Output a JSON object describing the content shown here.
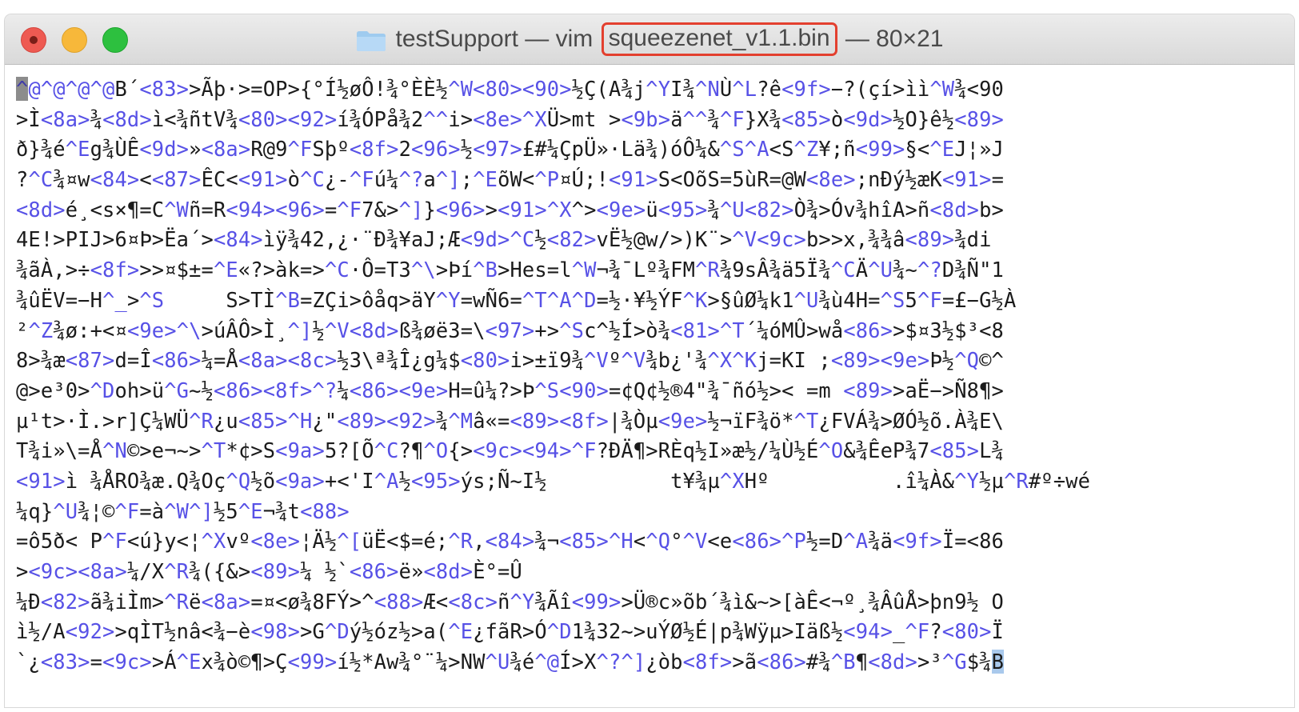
{
  "window": {
    "title_prefix": "testSupport — vim ",
    "title_file": "squeezenet_v1.1.bin",
    "title_suffix": " — 80×21",
    "controls": [
      "close",
      "minimize",
      "zoom"
    ]
  },
  "colors": {
    "text": "#1b1b1b",
    "special": "#5751e6",
    "highlight_box": "#e3402f",
    "cursor": "#8c8c8c"
  },
  "editor": {
    "lines": [
      "^@^@^@^@B´<83>>Ãþ·>=OP>{°Í½øÔ!¾°ÈÈ½^W<80><90>½Ç(A¾j^YI¾^NÙ^L?ê<9f>−?(çí>ìì^W¾<90",
      ">Ì<8a>¾<8d>ì<¾ñtV¾<80><92>í¾ÓPå¾2^^i><8e>^XÜ>mt ><9b>ä^^¾^F}X¾<85>ò<9d>½O}ê½<89>",
      "ð}¾é^Eg¾ÙÊ<9d>»<8a>R@9^FSþº<8f>2<96>½<97>£#¼ÇpÜ»·Lä¾)óÔ¼&^S^A<S^Z¥;ñ<99>§<^EJ¦»J",
      "?^C¾¤w<84><<87>ÊC<<91>ò^C¿-^Fú¼^?a^];^EõW<^P¤Ú;!<91>S<OõS=5ùR=@W<8e>;nÐý½æK<91>=",
      "<8d>é¸<s×¶=C^Wñ=R<94><96>=^F7&>^]}<96>><91>^X^><9e>ü<95>¾^U<82>Ò¾>Óv¾hîA>ñ<8d>b>",
      "4E!>PIJ>6¤Þ>Ëa´><84>ìÿ¾42,¿·¨Ð¾¥aJ;Æ<9d>^C½<82>vË½@w/>)K¨>^V<9c>b>>x,¾¾â<89>¾di",
      "¾ãÀ,>÷<8f>>>¤$±=^E«?>àk=>^C·Ô=T3^\\>Þí^B>Hes=l^W¬¾¯Lº¾FM^R¾9sÂ¾ä5Ï¾^CÄ^U¾~^?D¾Ñ\"1",
      "¾ûËV=−H^_>^S     S>TÌ^B=ZÇi>ôåq>äY^Y=wÑ6=^T^A^D=½·¥½ÝF^K>§ûØ¼k1^U¾ù4H=^S5^F=£−G½À",
      "²^Z¾ø:+<¤<9e>^\\>úÂÔ>Ì¸^]½^V<8d>ß¾øë3=\\<97>+>^Sc^½Í>ò¾<81>^T´¼óMÛ>wå<86>>$¤3½$³<8",
      "8>¾æ<87>d=Î<86>¼=Å<8a><8c>½3\\ª¾Î¿g¼$<80>i>±ï9¾^Vº^V¾b¿'¾^X^Kj=KI ;<89><9e>Þ½^Q©^",
      "@>e³0>^Doh>ü^G~½<86><8f>^?¼<86><9e>H=û¼?>Þ^S<90>=¢Q¢½®4\"¾¯ñó½>< =m <89>>aË−>Ñ8¶>",
      "µ¹t>·Ì.>r]Ç¼WÜ^R¿u<85>^H¿\"<89><92>¾^Mâ«=<89><8f>|¾Òµ<9e>½¬ïF¾ö*^T¿FVÁ¾>ØÓ½õ.À¾E\\",
      "T¾i»\\=Å^N©>e¬~>^T*¢>S<9a>5?[Õ^C?¶^O{><9c><94>^F?ÐÄ¶>RÈq½I»æ½/¼Ù½É^O&¾ÊeP¾7<85>L¾",
      "<91>ì ¾ÅRO¾æ.Q¾Oç^Q½õ<9a>+<'I^A½<95>ýs;Ñ~I½          t¥¾µ^XHº          .î¼À&^Y½µ^R#º÷wé",
      "¼q}^U¾¦©^F=à^W^]½5^E¬¾t<88>",
      "=ô5ð< P^F<ú}y<¦^Xvº<8e>¦Ä½^[üË<$=é;^R,<84>¾¬<85>^H<^Q°^V<e<86>^P½=D^A¾ä<9f>Ï=<86",
      "><9c><8a>¼/X^R¾({&><89>¼ ½`<86>ë»<8d>È°=Û",
      "¼Ð<82>ã¾iÌm>^Rë<8a>=¤<ø¾8FÝ>^<88>Æ<<8c>ñ^Y¾Ãî<99>>Ü®c»õb´¾ì&~>[àÊ<¬º¸¾ÂûÅ>þn9½ O",
      "ì½/A<92>>qÌT½nâ<¾−è<98>>G^Dý½óz½>a(^E¿fãR>Ó^D1¾32~>uÝØ½É|p¾Wÿµ>Iäß½<94>_^F?<80>Ï",
      "`¿<83>=<9c>>Á^Ex¾ò©¶>Ç<99>í½*Aw¾°¨¼>NW^U¾é^@Í>X^?^]¿òb<8f>>ã<86>#¾^B¶<8d>>³^G$¾B"
    ]
  }
}
